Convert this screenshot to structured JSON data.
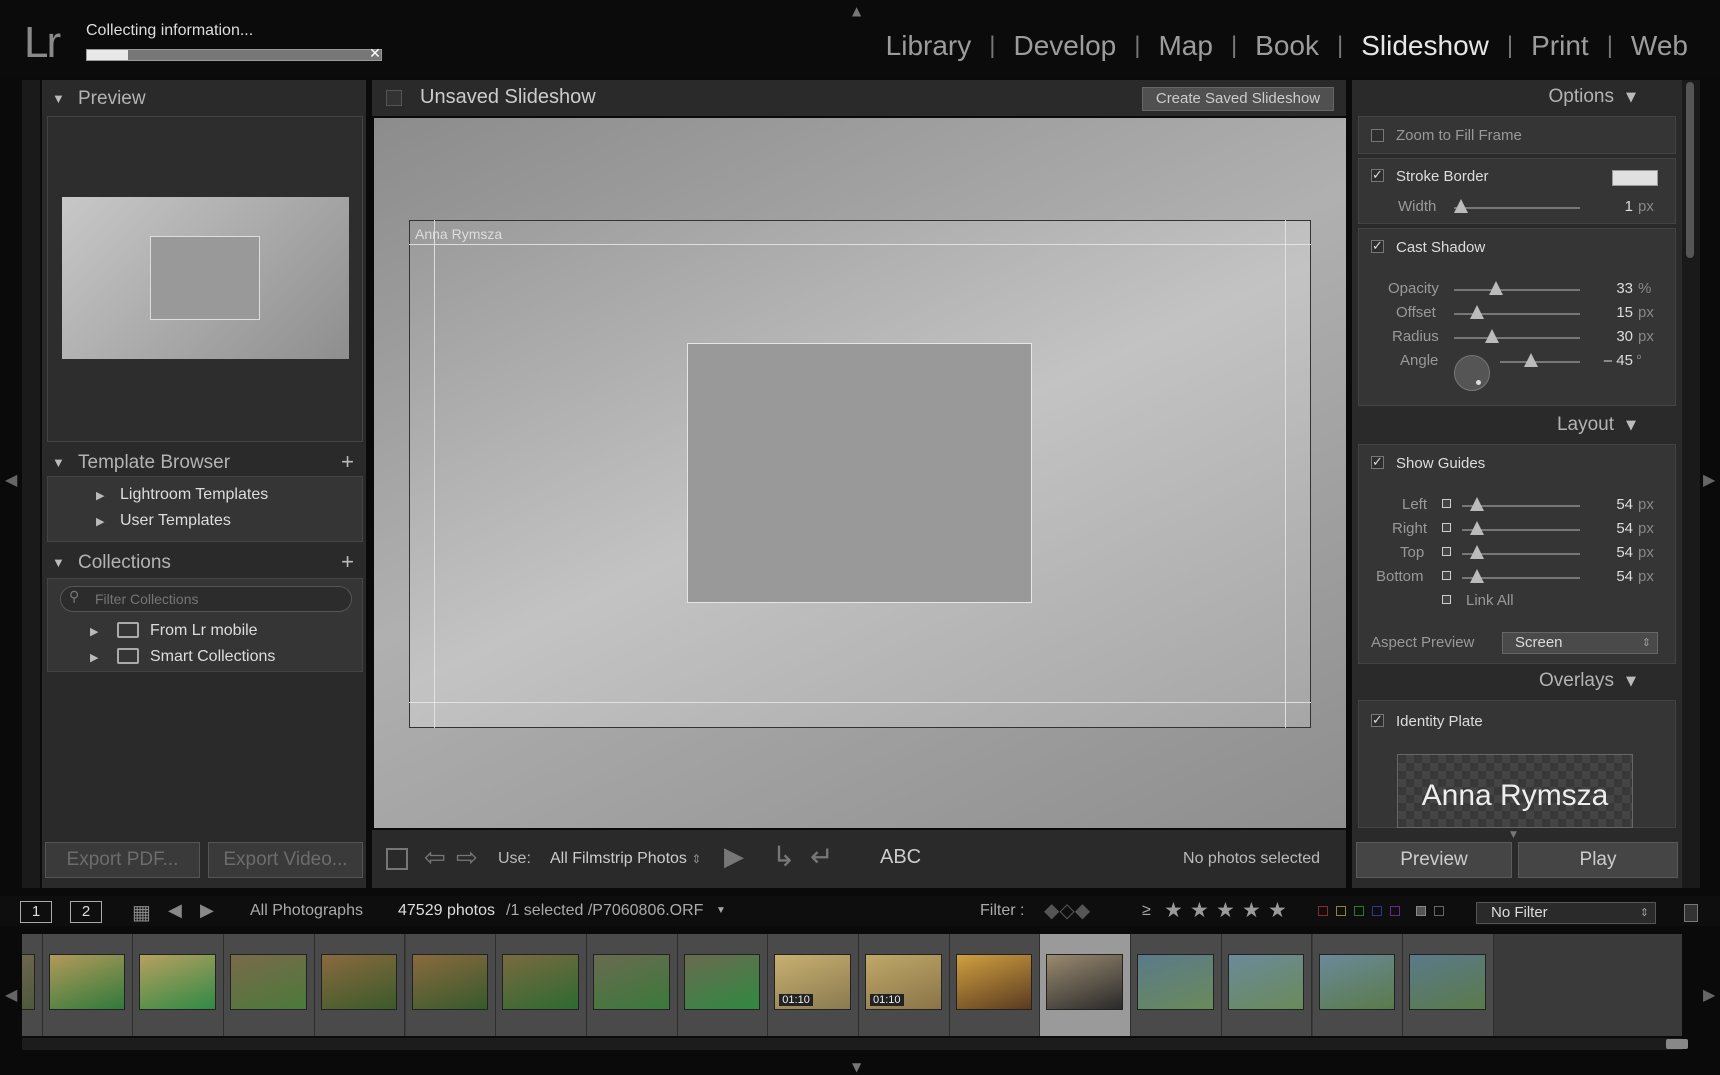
{
  "app": {
    "logo": "Lr"
  },
  "progress": {
    "text": "Collecting information...",
    "percent": 14
  },
  "modules": [
    {
      "label": "Library",
      "active": false
    },
    {
      "label": "Develop",
      "active": false
    },
    {
      "label": "Map",
      "active": false
    },
    {
      "label": "Book",
      "active": false
    },
    {
      "label": "Slideshow",
      "active": true
    },
    {
      "label": "Print",
      "active": false
    },
    {
      "label": "Web",
      "active": false
    }
  ],
  "left": {
    "preview_title": "Preview",
    "template_browser_title": "Template Browser",
    "templates": [
      "Lightroom Templates",
      "User Templates"
    ],
    "collections_title": "Collections",
    "filter_placeholder": "Filter Collections",
    "collections": [
      "From Lr mobile",
      "Smart Collections"
    ],
    "export_pdf": "Export PDF...",
    "export_video": "Export Video..."
  },
  "center": {
    "title": "Unsaved Slideshow",
    "create_saved": "Create Saved Slideshow",
    "identity_plate_text": "Anna Rymsza",
    "use_label": "Use:",
    "use_value": "All Filmstrip Photos",
    "abc_label": "ABC",
    "status": "No photos selected"
  },
  "options": {
    "title": "Options",
    "zoom_to_fill": {
      "label": "Zoom to Fill Frame",
      "checked": false
    },
    "stroke_border": {
      "label": "Stroke Border",
      "checked": true,
      "color": "#e0e0e0"
    },
    "width": {
      "label": "Width",
      "value": "1",
      "unit": "px"
    },
    "cast_shadow": {
      "label": "Cast Shadow",
      "checked": true
    },
    "opacity": {
      "label": "Opacity",
      "value": "33",
      "unit": "%"
    },
    "offset": {
      "label": "Offset",
      "value": "15",
      "unit": "px"
    },
    "radius": {
      "label": "Radius",
      "value": "30",
      "unit": "px"
    },
    "angle": {
      "label": "Angle",
      "value": "– 45",
      "unit": "°"
    }
  },
  "layout": {
    "title": "Layout",
    "show_guides": {
      "label": "Show Guides",
      "checked": true
    },
    "left": {
      "label": "Left",
      "value": "54",
      "unit": "px"
    },
    "right": {
      "label": "Right",
      "value": "54",
      "unit": "px"
    },
    "top": {
      "label": "Top",
      "value": "54",
      "unit": "px"
    },
    "bottom": {
      "label": "Bottom",
      "value": "54",
      "unit": "px"
    },
    "link_all": "Link All",
    "aspect_label": "Aspect Preview",
    "aspect_value": "Screen"
  },
  "overlays": {
    "title": "Overlays",
    "identity_plate": {
      "label": "Identity Plate",
      "checked": true
    },
    "plate_text": "Anna Rymsza"
  },
  "buttons": {
    "preview": "Preview",
    "play": "Play"
  },
  "filmbar": {
    "monitor1": "1",
    "monitor2": "2",
    "source": "All Photographs",
    "count": "47529 photos",
    "selected": "/1 selected /P7060806.ORF",
    "filter_label": "Filter :",
    "gte": "≥",
    "no_filter": "No Filter"
  },
  "filmstrip": {
    "thumbs": [
      {
        "c1": "#7a6a58",
        "c2": "#4d5a3a",
        "dur": ""
      },
      {
        "c1": "#b39a5a",
        "c2": "#2f7a3a",
        "dur": ""
      },
      {
        "c1": "#b8a060",
        "c2": "#2e8a44",
        "dur": ""
      },
      {
        "c1": "#7a6a4a",
        "c2": "#4a7a3a",
        "dur": ""
      },
      {
        "c1": "#8a6a3e",
        "c2": "#3a5a2a",
        "dur": ""
      },
      {
        "c1": "#8a6a3e",
        "c2": "#365a2c",
        "dur": ""
      },
      {
        "c1": "#7a6a40",
        "c2": "#2d6a30",
        "dur": ""
      },
      {
        "c1": "#6a6a50",
        "c2": "#3a7a3a",
        "dur": ""
      },
      {
        "c1": "#6a6a50",
        "c2": "#2f8a40",
        "dur": ""
      },
      {
        "c1": "#c8b070",
        "c2": "#8a7a50",
        "dur": "01:10"
      },
      {
        "c1": "#c0a868",
        "c2": "#8a7448",
        "dur": "01:10"
      },
      {
        "c1": "#d0a040",
        "c2": "#5a3a20",
        "dur": ""
      },
      {
        "c1": "#9a8a70",
        "c2": "#2a2a2a",
        "dur": ""
      },
      {
        "c1": "#5a7a8a",
        "c2": "#6a8a5a",
        "dur": ""
      },
      {
        "c1": "#6a8a9a",
        "c2": "#6a8a5a",
        "dur": ""
      },
      {
        "c1": "#6a8a9a",
        "c2": "#5a7a4a",
        "dur": ""
      },
      {
        "c1": "#5a7a8a",
        "c2": "#5a7a4a",
        "dur": ""
      }
    ],
    "selected_index": 12
  }
}
